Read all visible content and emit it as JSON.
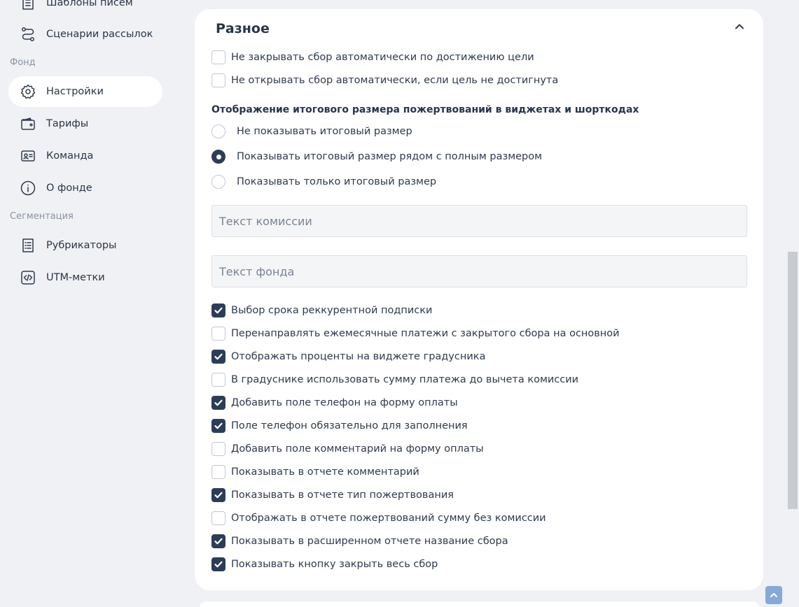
{
  "sidebar": {
    "items_top": [
      {
        "label": "Шаблоны писем",
        "icon": "document-list-icon"
      },
      {
        "label": "Сценарии рассылок",
        "icon": "route-icon"
      }
    ],
    "section_fond": "Фонд",
    "items_fond": [
      {
        "label": "Настройки",
        "icon": "gear-icon",
        "active": true
      },
      {
        "label": "Тарифы",
        "icon": "wallet-icon"
      },
      {
        "label": "Команда",
        "icon": "id-card-icon"
      },
      {
        "label": "О фонде",
        "icon": "info-icon"
      }
    ],
    "section_segmentation": "Сегментация",
    "items_segmentation": [
      {
        "label": "Рубрикаторы",
        "icon": "list-icon"
      },
      {
        "label": "UTM-метки",
        "icon": "code-icon"
      }
    ]
  },
  "card": {
    "title": "Разное",
    "top_checkboxes": [
      {
        "label": "Не закрывать сбор автоматически по достижению цели",
        "checked": false
      },
      {
        "label": "Не открывать сбор автоматически, если цель не достигнута",
        "checked": false
      }
    ],
    "display_heading": "Отображение итогового размера пожертвований в виджетах и шорткодах",
    "radios": [
      {
        "label": "Не показывать итоговый размер",
        "checked": false
      },
      {
        "label": "Показывать итоговый размер рядом с полным размером",
        "checked": true
      },
      {
        "label": "Показывать только итоговый размер",
        "checked": false
      }
    ],
    "commission_placeholder": "Текст комиссии",
    "fund_placeholder": "Текст фонда",
    "options": [
      {
        "label": "Выбор срока реккурентной подписки",
        "checked": true
      },
      {
        "label": "Перенаправлять ежемесячные платежи с закрытого сбора на основной",
        "checked": false
      },
      {
        "label": "Отображать проценты на виджете градусника",
        "checked": true
      },
      {
        "label": "В градуснике использовать сумму платежа до вычета комиссии",
        "checked": false
      },
      {
        "label": "Добавить поле телефон на форму оплаты",
        "checked": true
      },
      {
        "label": "Поле телефон обязательно для заполнения",
        "checked": true
      },
      {
        "label": "Добавить поле комментарий на форму оплаты",
        "checked": false
      },
      {
        "label": "Показывать в отчете комментарий",
        "checked": false
      },
      {
        "label": "Показывать в отчете тип пожертвования",
        "checked": true
      },
      {
        "label": "Отображать в отчете пожертвований сумму без комиссии",
        "checked": false
      },
      {
        "label": "Показывать в расширенном отчете название сбора",
        "checked": true
      },
      {
        "label": "Показывать кнопку закрыть весь сбор",
        "checked": true
      }
    ]
  },
  "colors": {
    "accent": "#2d3d56",
    "background": "#f0f1f4",
    "scroll_top_button": "#86a9d7"
  }
}
